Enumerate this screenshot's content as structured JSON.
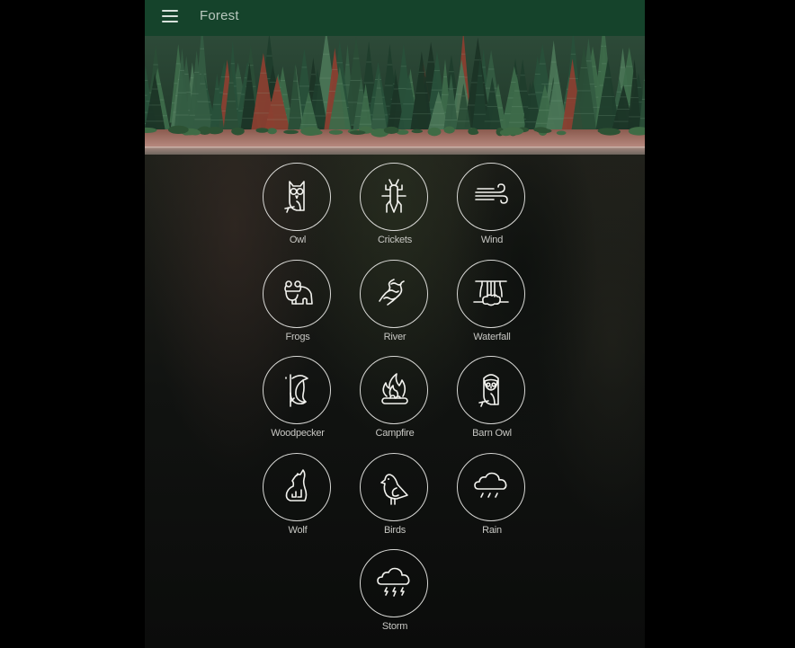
{
  "header": {
    "title": "Forest",
    "menu_icon": "hamburger-menu-icon",
    "background_color": "#15432b"
  },
  "banner": {
    "description": "Forest of pine trees beside a lake shore",
    "image_icon": "forest-banner-image"
  },
  "sounds": [
    {
      "label": "Owl",
      "icon": "owl-icon"
    },
    {
      "label": "Crickets",
      "icon": "cricket-icon"
    },
    {
      "label": "Wind",
      "icon": "wind-icon"
    },
    {
      "label": "Frogs",
      "icon": "frog-icon"
    },
    {
      "label": "River",
      "icon": "river-icon"
    },
    {
      "label": "Waterfall",
      "icon": "waterfall-icon"
    },
    {
      "label": "Woodpecker",
      "icon": "woodpecker-icon"
    },
    {
      "label": "Campfire",
      "icon": "campfire-icon"
    },
    {
      "label": "Barn Owl",
      "icon": "barn-owl-icon"
    },
    {
      "label": "Wolf",
      "icon": "wolf-icon"
    },
    {
      "label": "Birds",
      "icon": "bird-icon"
    },
    {
      "label": "Rain",
      "icon": "rain-icon"
    },
    {
      "label": "Storm",
      "icon": "storm-icon"
    }
  ]
}
